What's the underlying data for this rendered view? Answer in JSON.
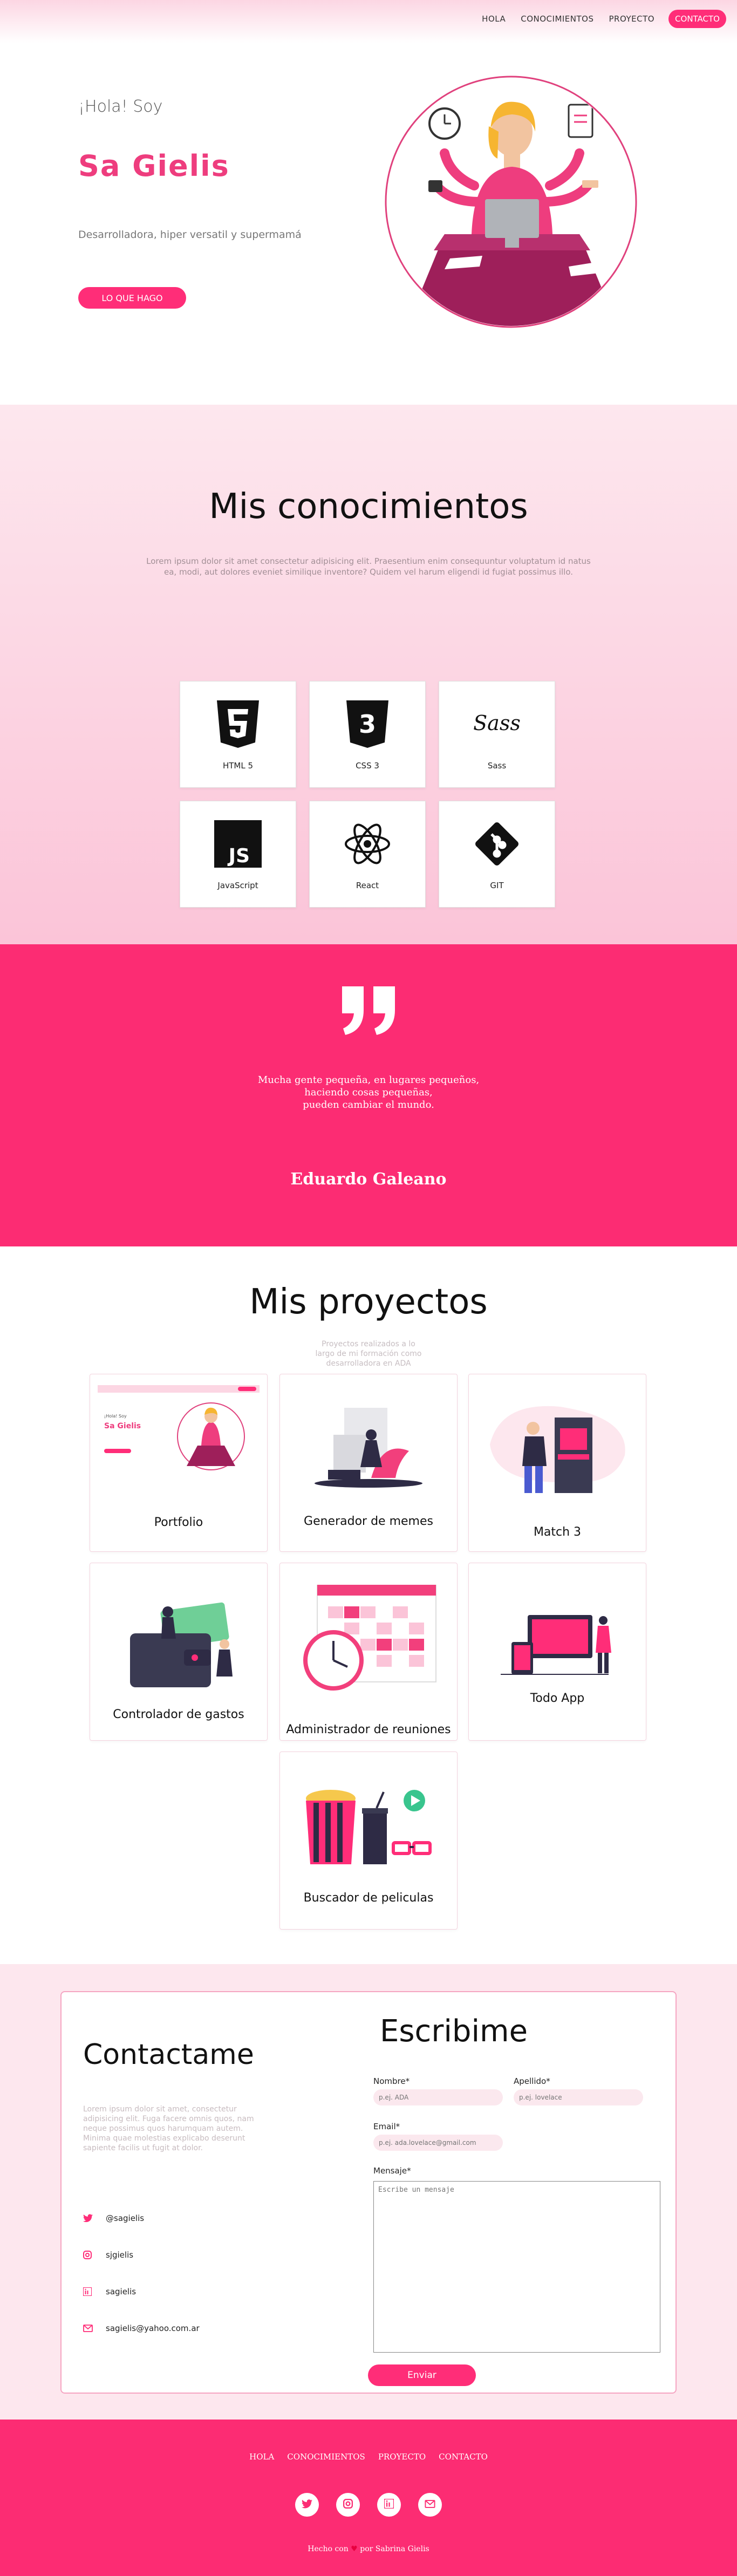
{
  "nav": {
    "links": [
      "HOLA",
      "CONOCIMIENTOS",
      "PROYECTO"
    ],
    "cta": "CONTACTO"
  },
  "hero": {
    "greeting": "¡Hola! Soy",
    "name": "Sa Gielis",
    "description": "Desarrolladora, hiper versatil y supermamá",
    "button": "LO QUE HAGO"
  },
  "skills": {
    "title": "Mis conocimientos",
    "lorem": "Lorem ipsum dolor sit amet consectetur adipisicing elit. Praesentium enim consequuntur voluptatum id natus ea, modi, aut dolores eveniet similique inventore? Quidem vel harum eligendi id fugiat possimus illo.",
    "items": [
      {
        "label": "HTML 5",
        "icon": "html5-icon"
      },
      {
        "label": "CSS 3",
        "icon": "css3-icon"
      },
      {
        "label": "Sass",
        "icon": "sass-icon"
      },
      {
        "label": "JavaScript",
        "icon": "javascript-icon"
      },
      {
        "label": "React",
        "icon": "react-icon"
      },
      {
        "label": "GIT",
        "icon": "git-icon"
      }
    ]
  },
  "quote": {
    "line1": "Mucha gente pequeña, en lugares pequeños,",
    "line2": "haciendo cosas pequeñas,",
    "line3": "pueden cambiar el mundo.",
    "author": "Eduardo Galeano"
  },
  "projects": {
    "title": "Mis proyectos",
    "subtitle": "Proyectos realizados a lo largo de mi formación como desarrolladora en ADA",
    "items": [
      {
        "title": "Portfolio"
      },
      {
        "title": "Generador de memes"
      },
      {
        "title": "Match 3"
      },
      {
        "title": "Controlador de gastos"
      },
      {
        "title": "Administrador de reuniones"
      },
      {
        "title": "Todo App"
      },
      {
        "title": "Buscador de peliculas"
      }
    ]
  },
  "contact": {
    "title": "Contactame",
    "lorem": "Lorem ipsum dolor sit amet, consectetur adipisicing elit. Fuga facere omnis quos, nam neque possimus quos harumquam autem. Minima quae molestias explicabo deserunt sapiente facilis ut fugit at dolor.",
    "social": [
      {
        "icon": "twitter-icon",
        "text": "@sagielis"
      },
      {
        "icon": "instagram-icon",
        "text": "sjgielis"
      },
      {
        "icon": "linkedin-icon",
        "text": "sagielis"
      },
      {
        "icon": "email-icon",
        "text": "sagielis@yahoo.com.ar"
      }
    ],
    "form_title": "Escribime",
    "nombre_label": "Nombre*",
    "nombre_placeholder": "p.ej. ADA",
    "apellido_label": "Apellido*",
    "apellido_placeholder": "p.ej. lovelace",
    "email_label": "Email*",
    "email_placeholder": "p.ej. ada.lovelace@gmail.com",
    "mensaje_label": "Mensaje*",
    "mensaje_placeholder": "Escribe un mensaje",
    "send": "Enviar"
  },
  "footer": {
    "links": [
      "HOLA",
      "CONOCIMIENTOS",
      "PROYECTO",
      "CONTACTO"
    ],
    "credit_before": "Hecho con",
    "credit_heart": "♥",
    "credit_after": "por Sabrina Gielis"
  },
  "colors": {
    "accent": "#fc2c73",
    "accent_light": "#fde7ee"
  }
}
